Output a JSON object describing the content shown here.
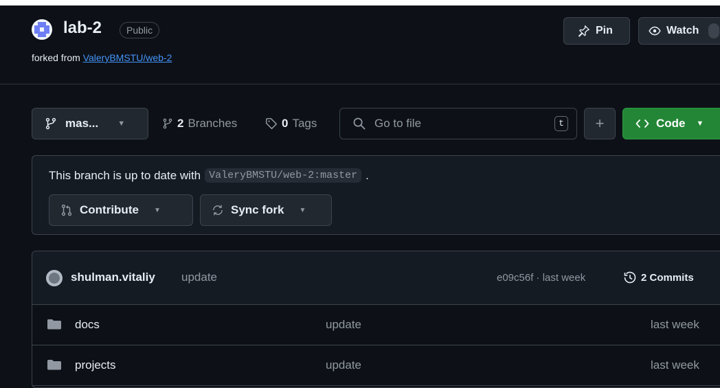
{
  "repo": {
    "name": "lab-2",
    "visibility": "Public",
    "forked_prefix": "forked from ",
    "forked_from": "ValeryBMSTU/web-2"
  },
  "actions": {
    "pin_label": "Pin",
    "watch_label": "Watch"
  },
  "toolbar": {
    "branch_label": "mas...",
    "branches_count": "2",
    "branches_label": "Branches",
    "tags_count": "0",
    "tags_label": "Tags",
    "search_placeholder": "Go to file",
    "search_shortcut": "t",
    "add_label": "+",
    "code_label": "Code"
  },
  "fork_status": {
    "text": "This branch is up to date with",
    "ref": "ValeryBMSTU/web-2:master",
    "suffix": ".",
    "contribute_label": "Contribute",
    "sync_label": "Sync fork"
  },
  "latest_commit": {
    "author": "shulman.vitaliy",
    "message": "update",
    "hash_time": "e09c56f · last week",
    "commits_label": "2 Commits"
  },
  "files": [
    {
      "name": "docs",
      "message": "update",
      "date": "last week"
    },
    {
      "name": "projects",
      "message": "update",
      "date": "last week"
    }
  ],
  "colors": {
    "background": "#0d1117",
    "accent_link": "#4493f8",
    "code_button": "#238636",
    "border": "#3d444d"
  }
}
